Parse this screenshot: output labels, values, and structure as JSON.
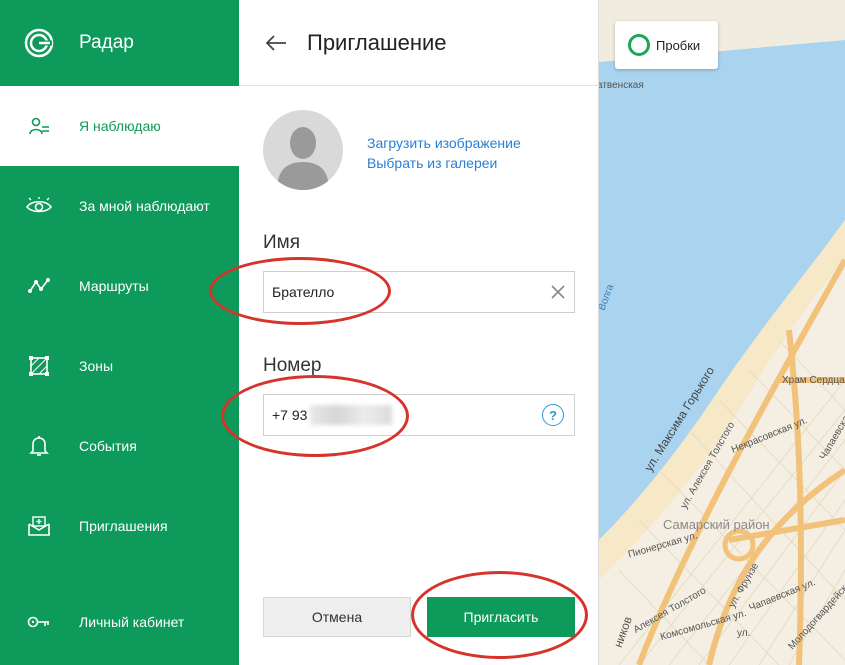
{
  "sidebar": {
    "brand": "Радар",
    "items": [
      {
        "label": "Я наблюдаю",
        "icon": "people-icon"
      },
      {
        "label": "За мной наблюдают",
        "icon": "eye-icon"
      },
      {
        "label": "Маршруты",
        "icon": "route-icon"
      },
      {
        "label": "Зоны",
        "icon": "zone-icon"
      },
      {
        "label": "События",
        "icon": "bell-icon"
      },
      {
        "label": "Приглашения",
        "icon": "invite-envelope-icon"
      },
      {
        "label": "Личный кабинет",
        "icon": "key-icon"
      }
    ],
    "active_index": 0,
    "accent_color": "#0e9a5a"
  },
  "panel": {
    "title": "Приглашение",
    "upload_link": "Загрузить изображение",
    "gallery_link": "Выбрать из галереи",
    "name_label": "Имя",
    "name_value": "Брателло",
    "phone_label": "Номер",
    "phone_value": "+7 93",
    "phone_help": "?",
    "cancel_label": "Отмена",
    "invite_label": "Пригласить"
  },
  "map": {
    "traffic_label": "Пробки",
    "labels": {
      "street_top": "атвенская",
      "volga": "Волга",
      "gorky": "ул. Максима Горького",
      "hram": "Храм Сердца",
      "nekrasov": "Некрасовская ул.",
      "tolstoy1": "ул. Алексея Толстого",
      "chapaev": "Чапаевская",
      "district": "Самарский район",
      "pioner": "Пионерская ул.",
      "frunze": "ул. Фрунзе",
      "chapaev2": "Чапаевская ул.",
      "tolstoy2": "Алексея Толстого",
      "komsomol": "Комсомольская ул.",
      "ul": "ул.",
      "molodogv": "Молодогвардейская",
      "nikov": "ников"
    }
  }
}
